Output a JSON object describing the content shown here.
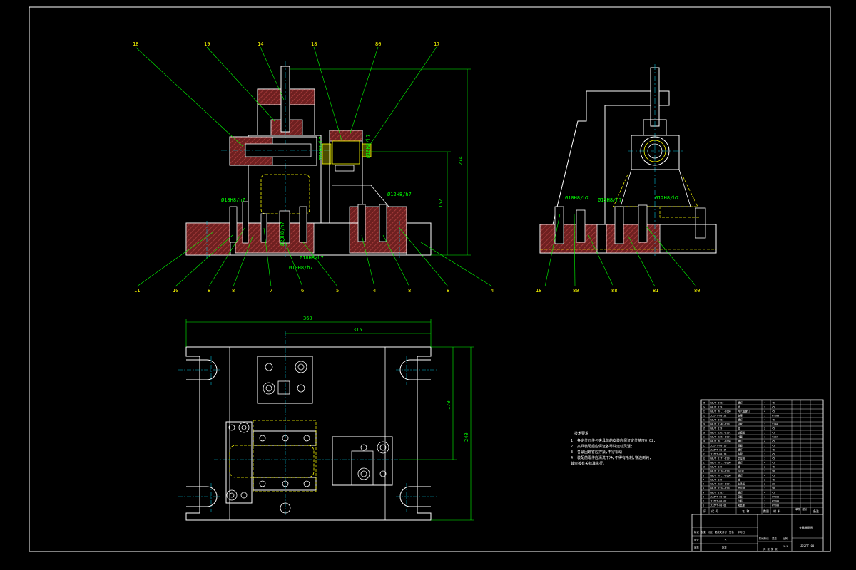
{
  "colors": {
    "background": "#000000",
    "outline": "#ffffff",
    "leader": "#00ff00",
    "label": "#ffff00",
    "hatch": "#8b2b2b",
    "hidden": "#ffff00",
    "center": "#00bcd4"
  },
  "front_view_labels": {
    "top": [
      "18",
      "19",
      "14",
      "18",
      "80",
      "17"
    ],
    "bottom": [
      "11",
      "10",
      "8",
      "8",
      "7",
      "6",
      "5",
      "4",
      "8",
      "8",
      "4"
    ]
  },
  "side_view_labels": {
    "bottom": [
      "18",
      "80",
      "88",
      "81",
      "80"
    ]
  },
  "dimensions": {
    "front_height_total": "274",
    "front_height_inner": "152",
    "plan_width": "360",
    "plan_width_inner": "315",
    "plan_depth": "240",
    "plan_depth_inner": "170"
  },
  "fit_notes": {
    "f1": "Ø18H8/h7",
    "f2": "Ø12H8/h7",
    "f3": "Ø18H8/h7",
    "f4": "Ø10H8/h7",
    "f5": "Ø10H8/h7",
    "f6": "Ø18H8/h7",
    "f7": "Ø20H8/h7",
    "f8": "Ø10H8/h7",
    "f9": "Ø12H8/h7"
  },
  "tech_requirements": {
    "title": "技术要求",
    "lines": [
      "1. 各定位元件与夹具体的安装应保证定位精度0.02;",
      "2. 夹具装配后应保证各零件运动灵活;",
      "3. 各紧固螺钉应拧紧,不得松动;",
      "4. 装配前零件应清洗干净,不得有毛刺,锐边倒钝;",
      "   其余按有关标准执行。"
    ]
  },
  "title_block": {
    "drawing_name": "夹具装配图",
    "drawing_no": "JJZPT-00",
    "header": [
      "序",
      "代 号",
      "名 称",
      "数量",
      "材 料",
      "单件",
      "总计",
      "备注"
    ],
    "bottom_labels": [
      "标记",
      "处数",
      "分区",
      "更改文件号",
      "签名",
      "年月日"
    ],
    "roles": [
      "设计",
      "审核",
      "工艺",
      "批准"
    ],
    "stage_labels": [
      "阶段标记",
      "重量",
      "比例"
    ],
    "scale": "1:1",
    "sheet": "共 张 第 张"
  },
  "bom_rows": [
    [
      "25",
      "GB/T 5783",
      "螺钉",
      "4",
      "45",
      ""
    ],
    [
      "24",
      "GB/T 119",
      "销",
      "2",
      "45",
      ""
    ],
    [
      "23",
      "GB/T 70.1-2000",
      "内六角螺钉",
      "4",
      "45",
      ""
    ],
    [
      "22",
      "JJZPT-00-22",
      "支座",
      "1",
      "HT200",
      ""
    ],
    [
      "21",
      "GB/T 5783",
      "螺钉",
      "4",
      "45",
      ""
    ],
    [
      "20",
      "GB/T 2148-1991",
      "钻套",
      "1",
      "T10A",
      ""
    ],
    [
      "19",
      "GB/T 119",
      "销",
      "2",
      "45",
      ""
    ],
    [
      "18",
      "GB/T 2262-1991",
      "钻模板",
      "1",
      "45",
      ""
    ],
    [
      "17",
      "GB/T 2263-1991",
      "衬套",
      "1",
      "T10A",
      ""
    ],
    [
      "16",
      "GB/T 70.1-2000",
      "螺钉",
      "4",
      "45",
      ""
    ],
    [
      "15",
      "JJZPT-00-15",
      "压板",
      "1",
      "45",
      ""
    ],
    [
      "14",
      "JJZPT-00-14",
      "螺杆",
      "1",
      "45",
      ""
    ],
    [
      "13",
      "JJZPT-00-13",
      "支架",
      "1",
      "45",
      ""
    ],
    [
      "12",
      "GB/T 2177-1991",
      "定位块",
      "1",
      "45",
      ""
    ],
    [
      "11",
      "GB/T 70.1-2000",
      "螺钉",
      "4",
      "45",
      ""
    ],
    [
      "10",
      "GB/T 119",
      "销",
      "2",
      "45",
      ""
    ],
    [
      "9",
      "GB/T 2210-1991",
      "V形块",
      "1",
      "T8",
      ""
    ],
    [
      "8",
      "GB/T 70.1-2000",
      "螺钉",
      "4",
      "45",
      ""
    ],
    [
      "7",
      "GB/T 119",
      "销",
      "2",
      "45",
      ""
    ],
    [
      "6",
      "GB/T 2220-1991",
      "支承板",
      "2",
      "20",
      ""
    ],
    [
      "5",
      "GB/T 2226-1991",
      "定位销",
      "1",
      "T8",
      ""
    ],
    [
      "4",
      "GB/T 5783",
      "螺钉",
      "4",
      "45",
      ""
    ],
    [
      "3",
      "JJZPT-00-03",
      "底板",
      "1",
      "HT200",
      ""
    ],
    [
      "2",
      "JJZPT-00-02",
      "立板",
      "1",
      "HT200",
      ""
    ],
    [
      "1",
      "JJZPT-00-01",
      "夹具体",
      "1",
      "HT200",
      ""
    ]
  ]
}
